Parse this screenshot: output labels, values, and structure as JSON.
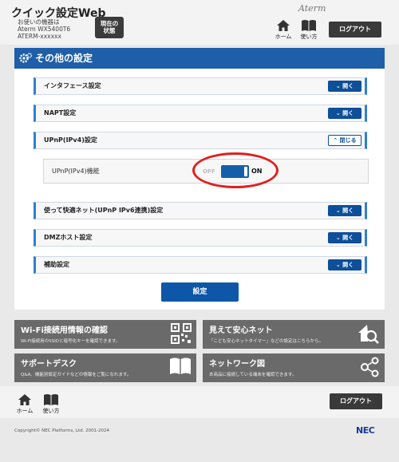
{
  "header": {
    "app_title": "クイック設定Web",
    "device_info": [
      "お使いの機器は",
      "Aterm WX5400T6",
      "ATERM-xxxxxx"
    ],
    "status_button": [
      "現在の",
      "状態"
    ],
    "home_label": "ホーム",
    "help_label": "使い方",
    "brand": "Aterm",
    "logout_label": "ログアウト"
  },
  "main": {
    "section_title": "その他の設定",
    "accordions": [
      {
        "label": "インタフェース設定",
        "button": "開く"
      },
      {
        "label": "NAPT設定",
        "button": "開く"
      },
      {
        "label": "UPnP(IPv4)設定",
        "button": "閉じる"
      },
      {
        "label": "使って快適ネット(UPnP IPv6連携)設定",
        "button": "開く"
      },
      {
        "label": "DMZホスト設定",
        "button": "開く"
      },
      {
        "label": "補助設定",
        "button": "開く"
      }
    ],
    "upnp_row": {
      "label": "UPnP(IPv4)機能",
      "off_label": "OFF",
      "on_label": "ON"
    },
    "submit_label": "設定"
  },
  "tiles": [
    {
      "title": "Wi-Fi接続用情報の確認",
      "desc": "Wi-Fi接続用のSSIDと暗号化キーを確認できます。",
      "icon": "qr-code-icon"
    },
    {
      "title": "見えて安心ネット",
      "desc": "「こども安心ネットタイマー」などの設定はこちらから。",
      "icon": "home-search-icon"
    },
    {
      "title": "サポートデスク",
      "desc": "Q&A、機能別設定ガイドなどの情報をご覧になれます。",
      "icon": "book-icon"
    },
    {
      "title": "ネットワーク図",
      "desc": "本商品に接続している端末を確認できます。",
      "icon": "network-icon"
    }
  ],
  "footer": {
    "home_label": "ホーム",
    "help_label": "使い方",
    "logout_label": "ログアウト",
    "copyright": "Copyright© NEC Platforms, Ltd. 2001-2024",
    "nec": "NEC"
  },
  "colors": {
    "primary": "#1f5ea8",
    "button": "#0d4f99",
    "highlight": "#e02020",
    "tile": "#6a6a6a"
  }
}
